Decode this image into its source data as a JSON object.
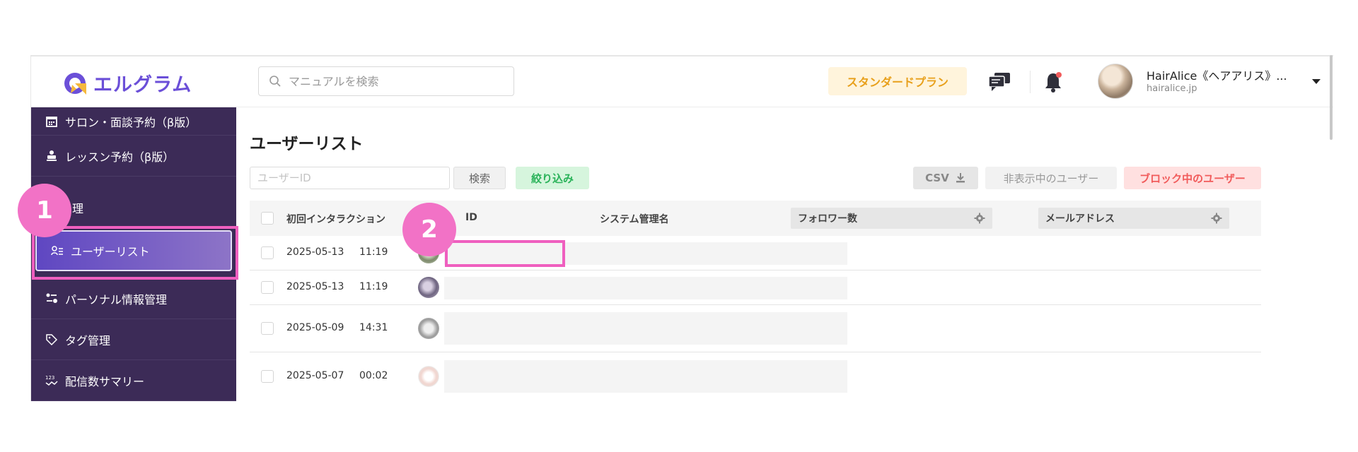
{
  "header": {
    "logo_text": "エルグラム",
    "search_placeholder": "マニュアルを検索",
    "plan_label": "スタンダードプラン",
    "account_name": "HairAlice《ヘアアリス》...",
    "account_domain": "hairalice.jp",
    "icons": [
      "search-icon",
      "chat-icon",
      "bell-icon",
      "chevron-down-icon"
    ],
    "brand_color": "#6b4fd8"
  },
  "sidebar": {
    "items": [
      {
        "label": "サロン・面談予約（β版）",
        "icon": "calendar-icon"
      },
      {
        "label": "レッスン予約（β版）",
        "icon": "lesson-icon"
      },
      {
        "label": "ユーザーリスト",
        "icon": "user-list-icon",
        "active": true
      },
      {
        "label": "パーソナル情報管理",
        "icon": "personal-info-icon"
      },
      {
        "label": "タグ管理",
        "icon": "tag-icon"
      },
      {
        "label": "配信数サマリー",
        "icon": "summary-icon"
      }
    ],
    "section_label": "理",
    "bg_color": "#3c2b57"
  },
  "callouts": {
    "one": "1",
    "two": "2",
    "color": "#f272c6"
  },
  "main": {
    "title": "ユーザーリスト",
    "userid_placeholder": "ユーザーID",
    "search_button": "検索",
    "filter_button": "絞り込み",
    "csv_button": "CSV",
    "hidden_users_button": "非表示中のユーザー",
    "blocked_users_button": "ブロック中のユーザー"
  },
  "table": {
    "columns": {
      "first_interaction": "初回インタラクション",
      "id": "ID",
      "system_name": "システム管理名",
      "followers": "フォロワー数",
      "email": "メールアドレス"
    },
    "rows": [
      {
        "date": "2025-05-13",
        "time": "11:19"
      },
      {
        "date": "2025-05-13",
        "time": "11:19"
      },
      {
        "date": "2025-05-09",
        "time": "14:31"
      },
      {
        "date": "2025-05-07",
        "time": "00:02"
      }
    ]
  }
}
